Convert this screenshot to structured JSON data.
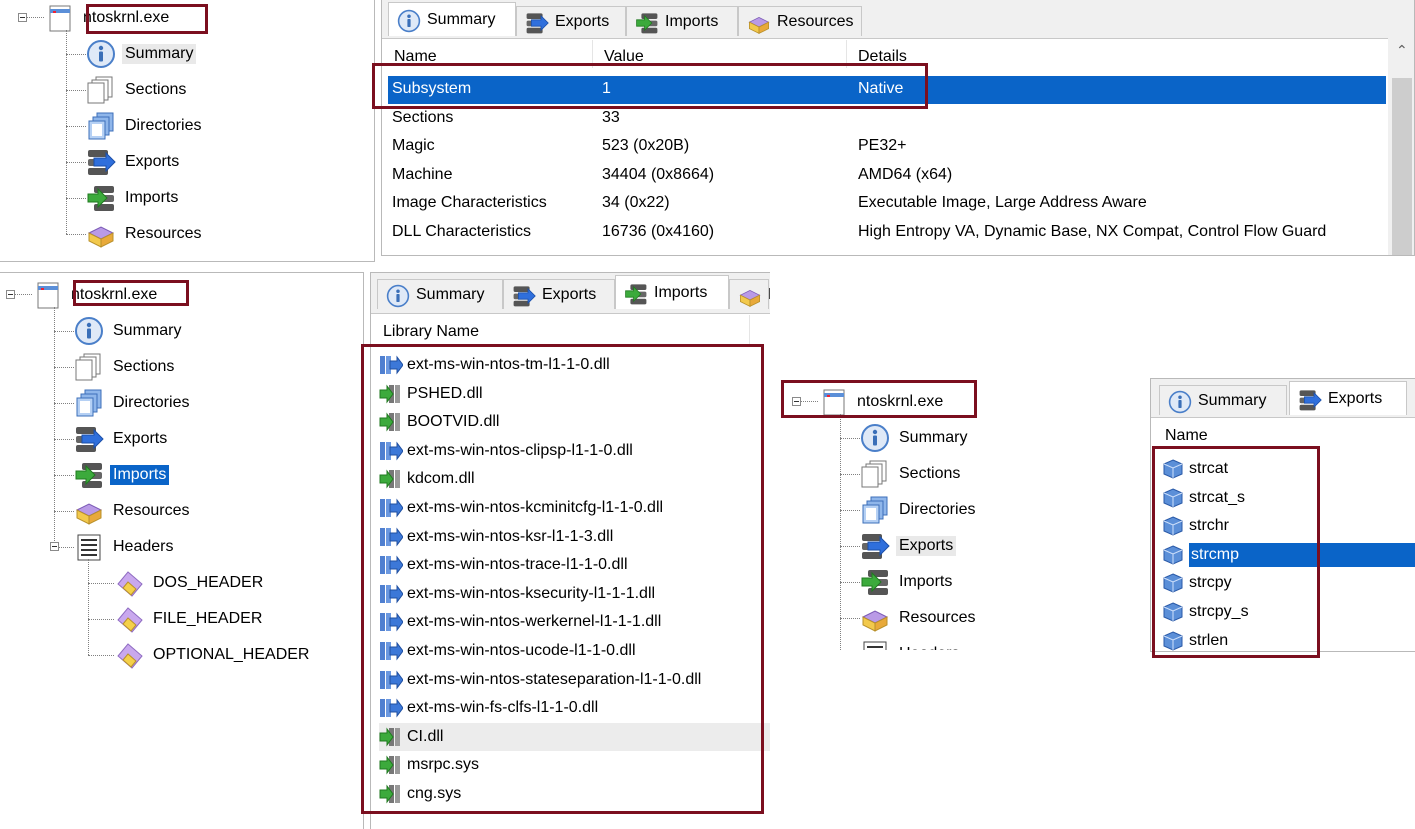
{
  "colors": {
    "selection": "#0a64c8",
    "highlight_box": "#7b0f1f"
  },
  "panel1": {
    "tree": {
      "root": "ntoskrnl.exe",
      "items": [
        {
          "label": "Summary",
          "icon": "info-icon",
          "state": "hover"
        },
        {
          "label": "Sections",
          "icon": "sections-icon"
        },
        {
          "label": "Directories",
          "icon": "directories-icon"
        },
        {
          "label": "Exports",
          "icon": "exports-icon"
        },
        {
          "label": "Imports",
          "icon": "imports-icon"
        },
        {
          "label": "Resources",
          "icon": "resources-icon"
        }
      ]
    },
    "tabs": [
      {
        "label": "Summary",
        "icon": "info-icon",
        "active": true
      },
      {
        "label": "Exports",
        "icon": "exports-icon"
      },
      {
        "label": "Imports",
        "icon": "imports-icon"
      },
      {
        "label": "Resources",
        "icon": "resources-icon"
      }
    ],
    "columns": [
      "Name",
      "Value",
      "Details"
    ],
    "rows": [
      {
        "name": "Subsystem",
        "value": "1",
        "details": "Native",
        "selected": true
      },
      {
        "name": "Sections",
        "value": "33",
        "details": ""
      },
      {
        "name": "Magic",
        "value": "523 (0x20B)",
        "details": "PE32+"
      },
      {
        "name": "Machine",
        "value": "34404 (0x8664)",
        "details": "AMD64 (x64)"
      },
      {
        "name": "Image Characteristics",
        "value": "34 (0x22)",
        "details": "Executable Image, Large Address Aware"
      },
      {
        "name": "DLL Characteristics",
        "value": "16736 (0x4160)",
        "details": "High Entropy VA, Dynamic Base, NX Compat, Control Flow Guard"
      }
    ]
  },
  "panel2": {
    "tree": {
      "root": "ntoskrnl.exe",
      "items": [
        {
          "label": "Summary",
          "icon": "info-icon"
        },
        {
          "label": "Sections",
          "icon": "sections-icon"
        },
        {
          "label": "Directories",
          "icon": "directories-icon"
        },
        {
          "label": "Exports",
          "icon": "exports-icon"
        },
        {
          "label": "Imports",
          "icon": "imports-icon",
          "state": "selected"
        },
        {
          "label": "Resources",
          "icon": "resources-icon"
        },
        {
          "label": "Headers",
          "icon": "headers-icon"
        }
      ],
      "subitems": [
        "DOS_HEADER",
        "FILE_HEADER",
        "OPTIONAL_HEADER"
      ]
    },
    "tabs": [
      {
        "label": "Summary",
        "icon": "info-icon"
      },
      {
        "label": "Exports",
        "icon": "exports-icon"
      },
      {
        "label": "Imports",
        "icon": "imports-icon",
        "active": true
      },
      {
        "label": "R",
        "icon": "resources-icon"
      }
    ],
    "column": "Library Name",
    "libraries": [
      {
        "name": "ext-ms-win-ntos-tm-l1-1-0.dll",
        "icon": "apiset-icon"
      },
      {
        "name": "PSHED.dll",
        "icon": "dll-icon"
      },
      {
        "name": "BOOTVID.dll",
        "icon": "dll-icon"
      },
      {
        "name": "ext-ms-win-ntos-clipsp-l1-1-0.dll",
        "icon": "apiset-icon"
      },
      {
        "name": "kdcom.dll",
        "icon": "dll-icon"
      },
      {
        "name": "ext-ms-win-ntos-kcminitcfg-l1-1-0.dll",
        "icon": "apiset-icon"
      },
      {
        "name": "ext-ms-win-ntos-ksr-l1-1-3.dll",
        "icon": "apiset-icon"
      },
      {
        "name": "ext-ms-win-ntos-trace-l1-1-0.dll",
        "icon": "apiset-icon"
      },
      {
        "name": "ext-ms-win-ntos-ksecurity-l1-1-1.dll",
        "icon": "apiset-icon"
      },
      {
        "name": "ext-ms-win-ntos-werkernel-l1-1-1.dll",
        "icon": "apiset-icon"
      },
      {
        "name": "ext-ms-win-ntos-ucode-l1-1-0.dll",
        "icon": "apiset-icon"
      },
      {
        "name": "ext-ms-win-ntos-stateseparation-l1-1-0.dll",
        "icon": "apiset-icon"
      },
      {
        "name": "ext-ms-win-fs-clfs-l1-1-0.dll",
        "icon": "apiset-icon"
      },
      {
        "name": "CI.dll",
        "icon": "dll-icon",
        "state": "hover"
      },
      {
        "name": "msrpc.sys",
        "icon": "dll-icon"
      },
      {
        "name": "cng.sys",
        "icon": "dll-icon"
      }
    ]
  },
  "panel3": {
    "tree": {
      "root": "ntoskrnl.exe",
      "items": [
        {
          "label": "Summary",
          "icon": "info-icon"
        },
        {
          "label": "Sections",
          "icon": "sections-icon"
        },
        {
          "label": "Directories",
          "icon": "directories-icon"
        },
        {
          "label": "Exports",
          "icon": "exports-icon",
          "state": "hover"
        },
        {
          "label": "Imports",
          "icon": "imports-icon"
        },
        {
          "label": "Resources",
          "icon": "resources-icon"
        },
        {
          "label": "Headers",
          "icon": "headers-icon"
        }
      ]
    },
    "tabs": [
      {
        "label": "Summary",
        "icon": "info-icon"
      },
      {
        "label": "Exports",
        "icon": "exports-icon",
        "active": true
      }
    ],
    "column": "Name",
    "exports": [
      {
        "name": "strcat"
      },
      {
        "name": "strcat_s"
      },
      {
        "name": "strchr"
      },
      {
        "name": "strcmp",
        "selected": true
      },
      {
        "name": "strcpy"
      },
      {
        "name": "strcpy_s"
      },
      {
        "name": "strlen"
      }
    ]
  }
}
